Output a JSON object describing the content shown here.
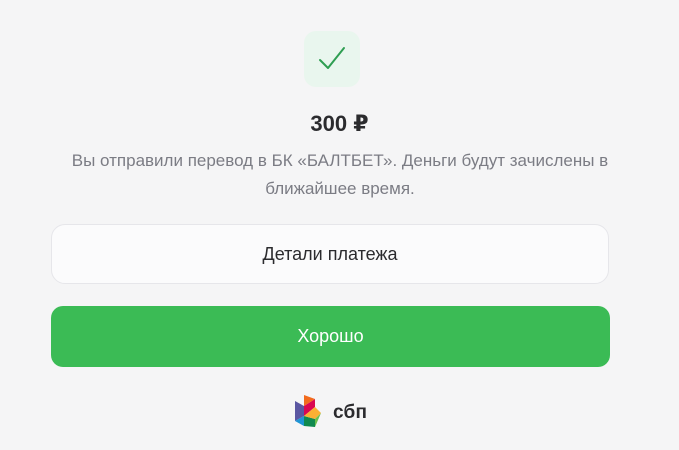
{
  "status": {
    "icon": "checkmark-icon",
    "accent_color": "#2f9e52"
  },
  "amount": "300 ₽",
  "message": "Вы отправили перевод в БК «БАЛТБЕТ». Деньги будут зачислены в ближайшее время.",
  "buttons": {
    "details_label": "Детали платежа",
    "ok_label": "Хорошо",
    "ok_color": "#3bbb55"
  },
  "logo": {
    "text": "сбп",
    "icon": "sbp-logo-icon"
  }
}
